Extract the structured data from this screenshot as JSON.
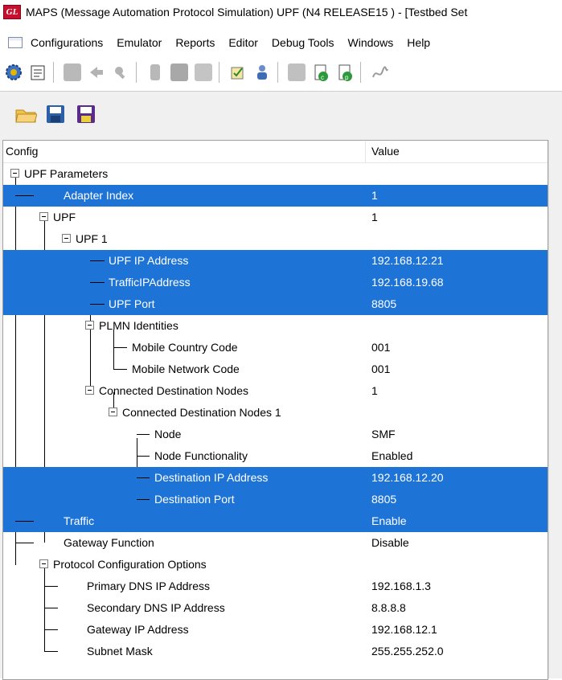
{
  "window": {
    "title": "MAPS (Message Automation Protocol Simulation) UPF (N4 RELEASE15 ) - [Testbed Set",
    "logo": "GL"
  },
  "menu": [
    "Configurations",
    "Emulator",
    "Reports",
    "Editor",
    "Debug Tools",
    "Windows",
    "Help"
  ],
  "toolbar_icons": [
    "gear-icon",
    "notepad-icon",
    "script-gray-icon",
    "arrow-gray-icon",
    "tool-gray-icon",
    "phone-gray-icon",
    "bag-gray-icon",
    "square-gray-icon",
    "checklist-icon",
    "person-icon",
    "square-gray-icon",
    "call-generate-icon",
    "call-process-icon",
    "signature-icon"
  ],
  "panel_tools": [
    "open-folder-icon",
    "save-icon",
    "save-as-icon"
  ],
  "columns": {
    "config": "Config",
    "value": "Value"
  },
  "rows": [
    {
      "label": "UPF Parameters",
      "value": "",
      "selected": false
    },
    {
      "label": "Adapter Index",
      "value": "1",
      "selected": true
    },
    {
      "label": "UPF",
      "value": "1",
      "selected": false
    },
    {
      "label": "UPF 1",
      "value": "",
      "selected": false
    },
    {
      "label": "UPF IP Address",
      "value": "192.168.12.21",
      "selected": true
    },
    {
      "label": "TrafficIPAddress",
      "value": "192.168.19.68",
      "selected": true
    },
    {
      "label": "UPF Port",
      "value": "8805",
      "selected": true
    },
    {
      "label": "PLMN Identities",
      "value": "",
      "selected": false
    },
    {
      "label": "Mobile Country Code",
      "value": "001",
      "selected": false
    },
    {
      "label": "Mobile Network Code",
      "value": "001",
      "selected": false
    },
    {
      "label": "Connected Destination Nodes",
      "value": "1",
      "selected": false
    },
    {
      "label": "Connected Destination Nodes 1",
      "value": "",
      "selected": false
    },
    {
      "label": "Node",
      "value": "SMF",
      "selected": false
    },
    {
      "label": "Node Functionality",
      "value": "Enabled",
      "selected": false
    },
    {
      "label": "Destination IP Address",
      "value": "192.168.12.20",
      "selected": true
    },
    {
      "label": "Destination Port",
      "value": "8805",
      "selected": true
    },
    {
      "label": "Traffic",
      "value": "Enable",
      "selected": true
    },
    {
      "label": "Gateway Function",
      "value": "Disable",
      "selected": false
    },
    {
      "label": "Protocol Configuration Options",
      "value": "",
      "selected": false
    },
    {
      "label": "Primary DNS IP Address",
      "value": "192.168.1.3",
      "selected": false
    },
    {
      "label": "Secondary DNS IP Address",
      "value": "8.8.8.8",
      "selected": false
    },
    {
      "label": "Gateway IP Address",
      "value": "192.168.12.1",
      "selected": false
    },
    {
      "label": "Subnet Mask",
      "value": "255.255.252.0",
      "selected": false
    }
  ],
  "colors": {
    "selection": "#1e74d6"
  }
}
